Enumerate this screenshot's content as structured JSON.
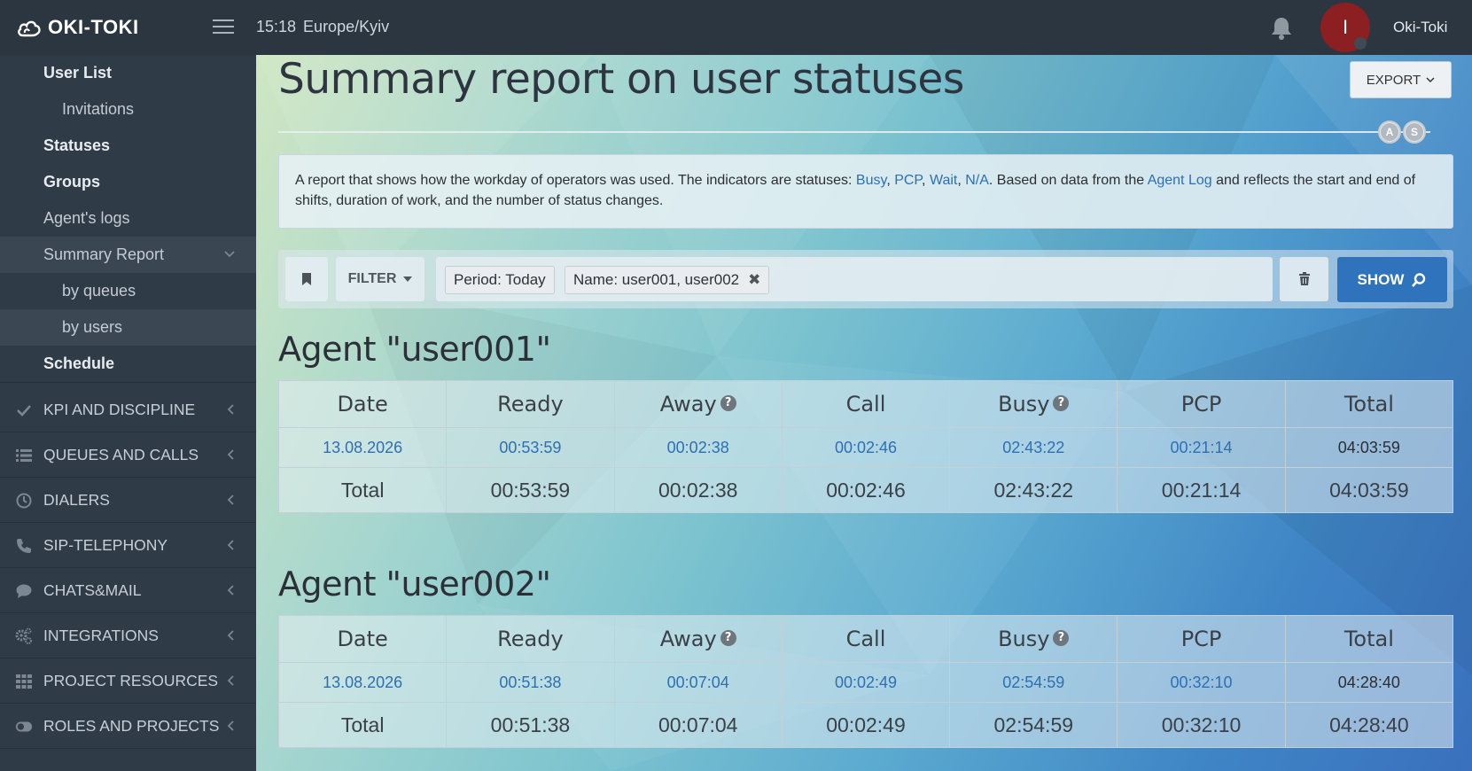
{
  "app": {
    "logo_text": "OKI-TOKI",
    "time": "15:18",
    "timezone": "Europe/Kyiv",
    "user_initial": "I",
    "username": "Oki-Toki"
  },
  "sidebar": {
    "subitems": [
      {
        "label": "User List"
      },
      {
        "label": "Invitations"
      },
      {
        "label": "Statuses"
      },
      {
        "label": "Groups"
      },
      {
        "label": "Agent's logs"
      },
      {
        "label": "Summary Report"
      },
      {
        "label": "by queues"
      },
      {
        "label": "by users"
      },
      {
        "label": "Schedule"
      }
    ],
    "sections": [
      {
        "label": "KPI AND DISCIPLINE",
        "icon": "check-icon"
      },
      {
        "label": "QUEUES AND CALLS",
        "icon": "list-icon"
      },
      {
        "label": "DIALERS",
        "icon": "clock-icon"
      },
      {
        "label": "SIP-TELEPHONY",
        "icon": "phone-icon"
      },
      {
        "label": "CHATS&MAIL",
        "icon": "chat-icon"
      },
      {
        "label": "INTEGRATIONS",
        "icon": "gears-icon"
      },
      {
        "label": "PROJECT RESOURCES",
        "icon": "grid-icon"
      },
      {
        "label": "ROLES AND PROJECTS",
        "icon": "toggle-icon"
      }
    ]
  },
  "page": {
    "title": "Summary report on user statuses",
    "export_label": "EXPORT",
    "badges": [
      "A",
      "S"
    ],
    "info": {
      "t1": "A report that shows how the workday of operators was used. The indicators are statuses: ",
      "busy": "Busy",
      "sep1": ", ",
      "pcp": "PCP",
      "sep2": ", ",
      "wait": "Wait",
      "sep3": ", ",
      "na": "N/A",
      "t2": ". Based on data from the ",
      "agent_log": "Agent Log",
      "t3": " and reflects the start and end of shifts, duration of work, and the number of status changes."
    },
    "filter": {
      "filter_label": "FILTER",
      "tags": [
        "Period: Today",
        "Name: user001, user002"
      ],
      "show_label": "SHOW"
    }
  },
  "columns": [
    "Date",
    "Ready",
    "Away",
    "Call",
    "Busy",
    "PCP",
    "Total"
  ],
  "agents": [
    {
      "title": "Agent \"user001\"",
      "row": [
        "13.08.2026",
        "00:53:59",
        "00:02:38",
        "00:02:46",
        "02:43:22",
        "00:21:14",
        "04:03:59"
      ],
      "total": [
        "Total",
        "00:53:59",
        "00:02:38",
        "00:02:46",
        "02:43:22",
        "00:21:14",
        "04:03:59"
      ]
    },
    {
      "title": "Agent \"user002\"",
      "row": [
        "13.08.2026",
        "00:51:38",
        "00:07:04",
        "00:02:49",
        "02:54:59",
        "00:32:10",
        "04:28:40"
      ],
      "total": [
        "Total",
        "00:51:38",
        "00:07:04",
        "00:02:49",
        "02:54:59",
        "00:32:10",
        "04:28:40"
      ]
    }
  ]
}
